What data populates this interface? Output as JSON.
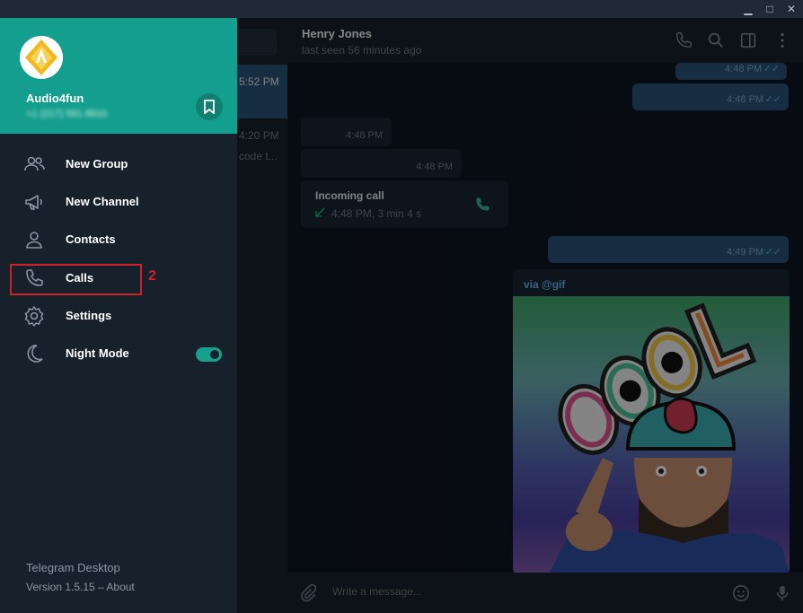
{
  "window": {
    "minimize_glyph": "▁",
    "maximize_glyph": "□",
    "close_glyph": "✕"
  },
  "chat_list": {
    "item1_time": "5:52 PM",
    "item2_time": "4:20 PM",
    "item2_preview": "code t..."
  },
  "chat_header": {
    "name": "Henry Jones",
    "status": "last seen 56 minutes ago"
  },
  "messages": [
    {
      "time": "4:48 PM",
      "dir": "out"
    },
    {
      "time": "4:48 PM",
      "dir": "out"
    },
    {
      "time": "4:48 PM",
      "dir": "in"
    },
    {
      "time": "4:48 PM",
      "dir": "in"
    },
    {
      "time": "4:49 PM",
      "dir": "out"
    }
  ],
  "call_message": {
    "title": "Incoming call",
    "info": "4:48 PM, 3 min 4 s"
  },
  "gif_message": {
    "via": "via @gif"
  },
  "composer": {
    "placeholder": "Write a message..."
  },
  "profile": {
    "name": "Audio4fun",
    "phone": "+1 (217) 581 8810"
  },
  "menu": [
    {
      "label": "New Group",
      "icon": "group-icon"
    },
    {
      "label": "New Channel",
      "icon": "megaphone-icon"
    },
    {
      "label": "Contacts",
      "icon": "person-icon"
    },
    {
      "label": "Calls",
      "icon": "phone-icon"
    },
    {
      "label": "Settings",
      "icon": "gear-icon"
    },
    {
      "label": "Night Mode",
      "icon": "moon-icon"
    }
  ],
  "annotation": {
    "step": "2"
  },
  "night_mode_enabled": true,
  "footer": {
    "app_name": "Telegram Desktop",
    "version": "Version 1.5.15 – About"
  },
  "colors": {
    "accent": "#149e8d",
    "highlight": "#d0202a",
    "background": "#17212b"
  }
}
